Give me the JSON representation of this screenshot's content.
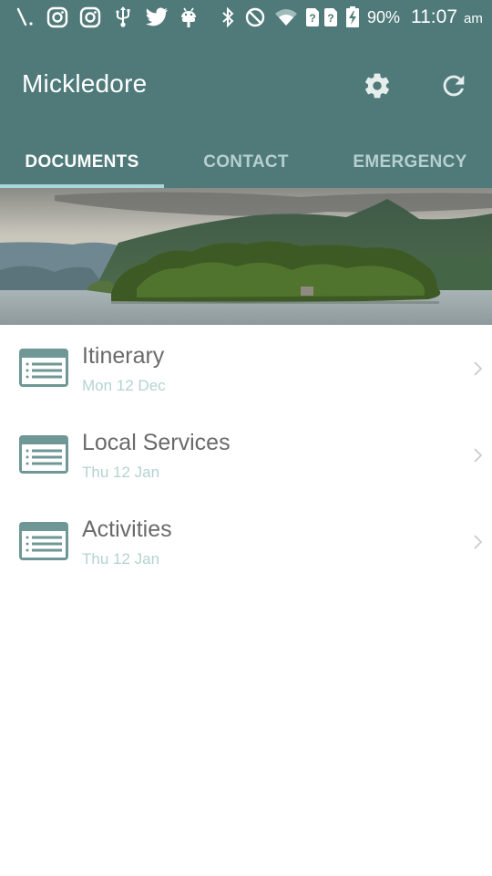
{
  "status_bar": {
    "icons": [
      "signal-slash-icon",
      "instagram-icon",
      "instagram-icon",
      "usb-icon",
      "twitter-icon",
      "android-icon",
      "bluetooth-icon",
      "do-not-disturb-icon",
      "wifi-icon",
      "sim-unknown-icon",
      "sim-unknown-icon",
      "battery-charging-icon"
    ],
    "battery": "90%",
    "time": "11:07",
    "ampm": "am"
  },
  "app_bar": {
    "title": "Mickledore",
    "actions": [
      "settings-icon",
      "refresh-icon"
    ]
  },
  "tabs": [
    {
      "label": "DOCUMENTS",
      "active": true
    },
    {
      "label": "CONTACT",
      "active": false
    },
    {
      "label": "EMERGENCY",
      "active": false
    }
  ],
  "banner": {
    "description": "Lake with wooded island and mountains"
  },
  "documents": [
    {
      "title": "Itinerary",
      "date": "Mon 12 Dec"
    },
    {
      "title": "Local Services",
      "date": "Thu 12 Jan"
    },
    {
      "title": "Activities",
      "date": "Thu 12 Jan"
    }
  ],
  "colors": {
    "primary": "#4f7a79",
    "tab_indicator": "#a9d6d6",
    "icon": "#6e9796",
    "title_text": "#6a6a6a",
    "date_text": "#b3d3d2"
  }
}
